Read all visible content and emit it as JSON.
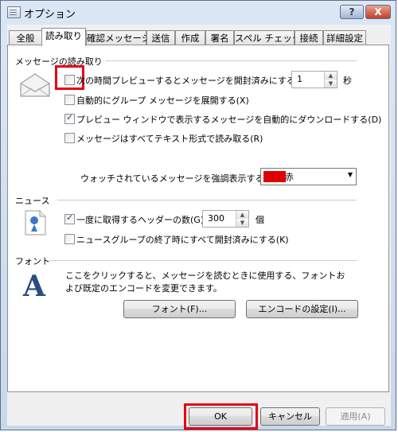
{
  "window": {
    "title": "オプション",
    "help_label": "?",
    "close_label": "X"
  },
  "tabs": [
    {
      "label": "全般"
    },
    {
      "label": "読み取り"
    },
    {
      "label": "確認メッセージ"
    },
    {
      "label": "送信"
    },
    {
      "label": "作成"
    },
    {
      "label": "署名"
    },
    {
      "label": "スペル チェック"
    },
    {
      "label": "接続"
    },
    {
      "label": "詳細設定"
    }
  ],
  "active_tab": "読み取り",
  "reading": {
    "section_title": "メッセージの読み取り",
    "mark_read": {
      "label": "次の時間プレビューするとメッセージを開封済みにする(M)",
      "checked": false
    },
    "seconds": {
      "value": "1",
      "unit": "秒"
    },
    "expand_groups": {
      "label": "自動的にグループ メッセージを展開する(X)",
      "checked": false
    },
    "auto_download": {
      "label": "プレビュー ウィンドウで表示するメッセージを自動的にダウンロードする(D)",
      "checked": true
    },
    "plain_text": {
      "label": "メッセージはすべてテキスト形式で読み取る(R)",
      "checked": false
    },
    "watched_label": "ウォッチされているメッセージを強調表示する",
    "watched_color": {
      "name": "赤",
      "hex": "#e00000"
    }
  },
  "news": {
    "section_title": "ニュース",
    "get_headers": {
      "label": "一度に取得するヘッダーの数(G)",
      "checked": true
    },
    "header_count": {
      "value": "300",
      "unit": "個"
    },
    "mark_all_read": {
      "label": "ニュースグループの終了時にすべて開封済みにする(K)",
      "checked": false
    }
  },
  "fonts": {
    "section_title": "フォント",
    "description": "ここをクリックすると、メッセージを読むときに使用する、フォントおよび既定のエンコードを変更できます。",
    "font_button": "フォント(F)...",
    "encoding_button": "エンコードの設定(I)..."
  },
  "footer": {
    "ok": "OK",
    "cancel": "キャンセル",
    "apply": "適用(A)"
  },
  "highlight_color": "#e60012"
}
